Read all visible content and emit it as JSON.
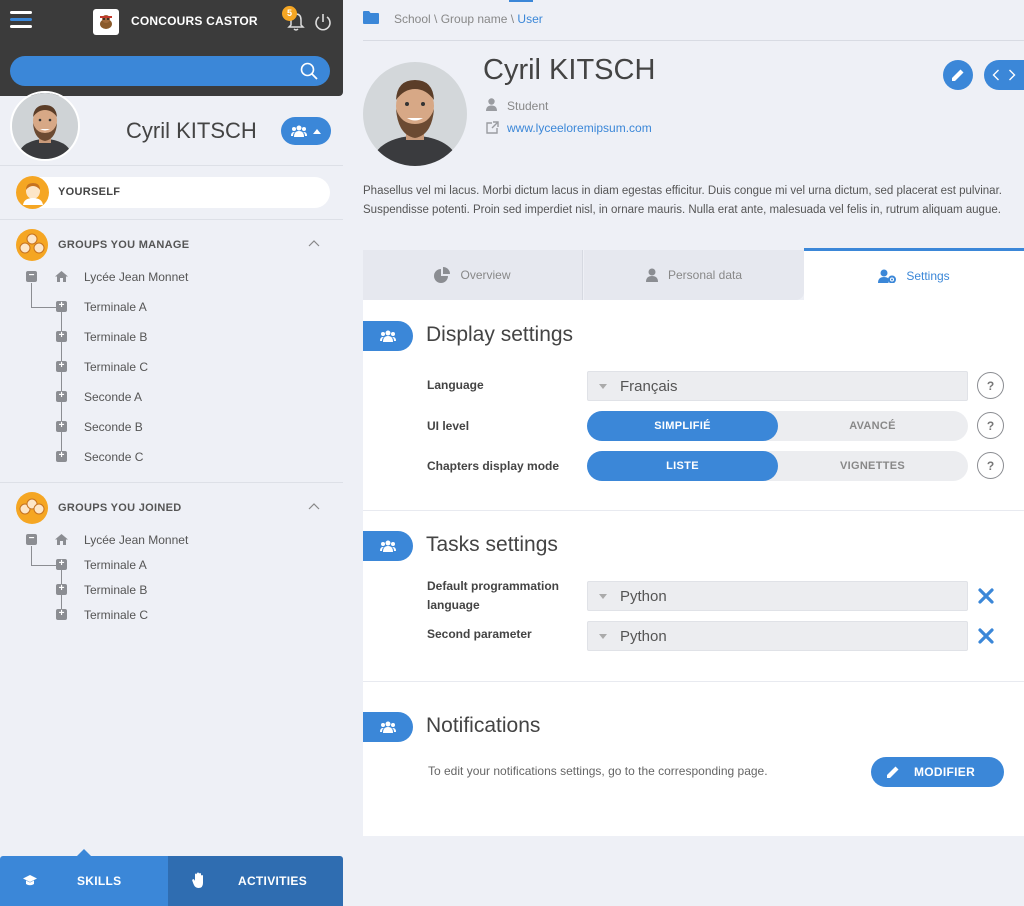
{
  "app": {
    "title": "CONCOURS CASTOR",
    "notification_count": "5"
  },
  "search": {
    "placeholder": "",
    "value": ""
  },
  "sidebar": {
    "user_name": "Cyril KITSCH",
    "yourself_label": "YOURSELF",
    "managed": {
      "label": "GROUPS YOU MANAGE",
      "root": "Lycée Jean Monnet",
      "children": [
        "Terminale A",
        "Terminale B",
        "Terminale C",
        "Seconde A",
        "Seconde B",
        "Seconde C"
      ]
    },
    "joined": {
      "label": "GROUPS YOU JOINED",
      "root": "Lycée Jean Monnet",
      "children": [
        "Terminale A",
        "Terminale B",
        "Terminale C"
      ]
    },
    "bottom_tabs": {
      "skills": "SKILLS",
      "activities": "ACTIVITIES"
    }
  },
  "breadcrumb": {
    "path": "School \\ Group name \\ ",
    "current": "User"
  },
  "profile": {
    "name": "Cyril KITSCH",
    "role": "Student",
    "website": "www.lyceeloremipsum.com",
    "description": "Phasellus vel mi lacus. Morbi dictum lacus in diam egestas efficitur. Duis congue mi vel urna dictum, sed placerat est pulvinar. Suspendisse potenti. Proin sed imperdiet nisl, in ornare mauris. Nulla erat ante, malesuada vel felis in, rutrum aliquam augue."
  },
  "tabs": {
    "overview": "Overview",
    "personal": "Personal data",
    "settings": "Settings",
    "active": "settings"
  },
  "display_settings": {
    "title": "Display settings",
    "language_label": "Language",
    "language_value": "Français",
    "ui_level_label": "UI level",
    "ui_level_options": [
      "SIMPLIFIÉ",
      "AVANCÉ"
    ],
    "ui_level_selected": "SIMPLIFIÉ",
    "chapters_label": "Chapters display mode",
    "chapters_options": [
      "LISTE",
      "VIGNETTES"
    ],
    "chapters_selected": "LISTE",
    "help_glyph": "?"
  },
  "tasks_settings": {
    "title": "Tasks settings",
    "prog_lang_label": "Default programmation language",
    "prog_lang_value": "Python",
    "second_param_label": "Second parameter",
    "second_param_value": "Python"
  },
  "notifications": {
    "title": "Notifications",
    "text": "To edit your notifications settings, go to the corresponding page.",
    "button": "MODIFIER"
  },
  "colors": {
    "accent": "#3b87d8",
    "dark_bar": "#3b3b3b",
    "badge": "#f5a623",
    "activities_tab": "#2f6db1"
  }
}
